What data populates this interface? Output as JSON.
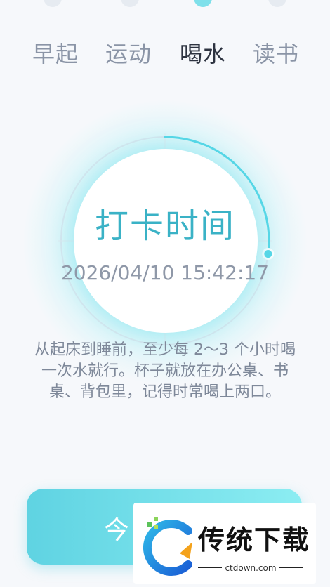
{
  "tabs": [
    {
      "label": "早起"
    },
    {
      "label": "运动"
    },
    {
      "label": "喝水",
      "active": true
    },
    {
      "label": "读书"
    }
  ],
  "clock": {
    "title": "打卡时间",
    "datetime": "2026/04/10 15:42:17",
    "progress_fraction": 0.27
  },
  "description": "从起床到睡前，至少每 2～3 个小时喝一次水就行。杯子就放在办公桌、书桌、背包里，记得时常喝上两口。",
  "checkin_button": {
    "label": "今"
  },
  "watermark": {
    "brand": "传统下载",
    "url": "ctdown.com"
  },
  "colors": {
    "accent": "#3ab2c6",
    "ring": "#56d6e6",
    "active_tab": "#2d3340",
    "inactive_tab": "#8a94a6"
  }
}
